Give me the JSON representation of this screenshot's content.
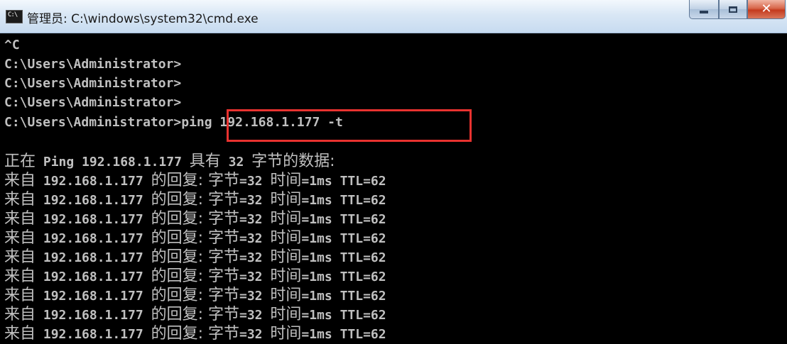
{
  "window": {
    "icon_text": "C:\\",
    "title": "管理员: C:\\windows\\system32\\cmd.exe"
  },
  "console": {
    "lines": [
      "^C",
      "C:\\Users\\Administrator>",
      "C:\\Users\\Administrator>",
      "C:\\Users\\Administrator>",
      "C:\\Users\\Administrator>ping 192.168.1.177 -t"
    ],
    "ping_header": {
      "prefix": "正在",
      "middle": " Ping 192.168.1.177 ",
      "suffix_a": "具有",
      "size": " 32 ",
      "suffix_b": "字节的数据:"
    },
    "reply": {
      "prefix": "来自",
      "ip": " 192.168.1.177 ",
      "word": "的回复:",
      "bytes_label": " 字节",
      "bytes": "=32 ",
      "time_label": "时间",
      "time": "=1ms ",
      "ttl": "TTL=62",
      "count": 9
    }
  },
  "highlight_color": "#e8322f"
}
